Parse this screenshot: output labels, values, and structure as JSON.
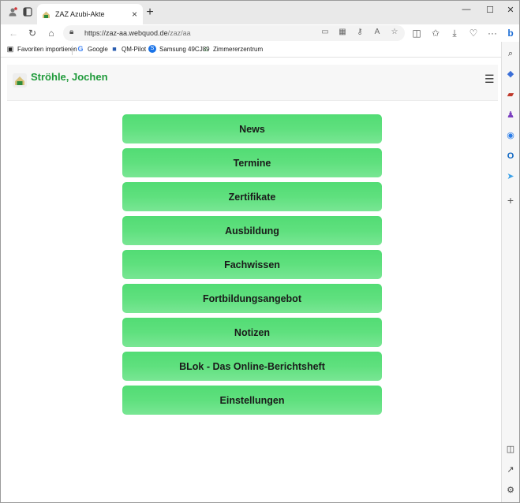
{
  "browser": {
    "tab_title": "ZAZ Azubi-Akte",
    "url_base": "https://zaz-aa.webquod.de",
    "url_path": "/zaz/aa",
    "favorites": [
      {
        "label": "Favoriten importieren",
        "icon": "import-icon"
      },
      {
        "label": "Google",
        "icon": "google-icon"
      },
      {
        "label": "QM-Pilot",
        "icon": "qm-pilot-icon"
      },
      {
        "label": "Samsung 49CJ89",
        "icon": "samsung-icon"
      },
      {
        "label": "Zimmererzentrum",
        "icon": "zaz-icon"
      }
    ]
  },
  "header": {
    "user_name": "Ströhle, Jochen"
  },
  "menu": {
    "items": [
      {
        "label": "News"
      },
      {
        "label": "Termine"
      },
      {
        "label": "Zertifikate"
      },
      {
        "label": "Ausbildung"
      },
      {
        "label": "Fachwissen"
      },
      {
        "label": "Fortbildungsangebot"
      },
      {
        "label": "Notizen"
      },
      {
        "label": "BLok - Das Online-Berichtsheft"
      },
      {
        "label": "Einstellungen"
      }
    ]
  },
  "colors": {
    "accent": "#1f9a3a",
    "button_green": "#5fe07e"
  }
}
